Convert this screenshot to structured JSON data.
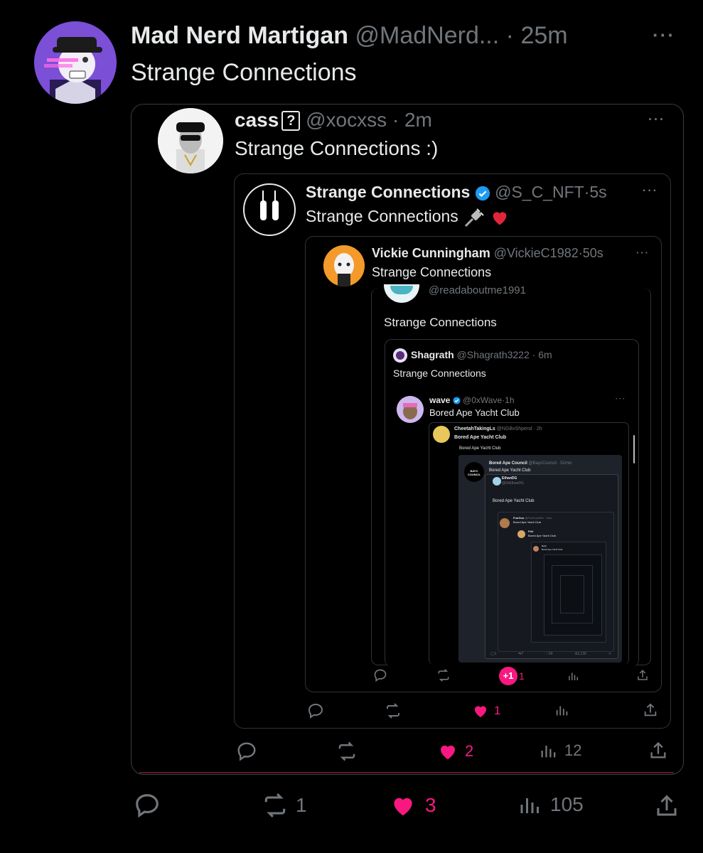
{
  "main": {
    "author": "Mad Nerd Martigan",
    "handle": "@MadNerd...",
    "sep": "·",
    "time": "25m",
    "text": "Strange Connections",
    "more": "···",
    "stats": {
      "reposts": "1",
      "likes": "3",
      "views": "105"
    }
  },
  "q1": {
    "author": "cass",
    "badge": "?",
    "handle": "@xocxss",
    "sep": "·",
    "time": "2m",
    "text": "Strange Connections :)",
    "more": "···",
    "stats": {
      "likes": "2",
      "views": "12"
    }
  },
  "q2": {
    "author": "Strange Connections",
    "handle": "@S_C_NFT",
    "sep": "·",
    "time": "5s",
    "text": "Strange Connections",
    "more": "···",
    "stats": {
      "likes": "1"
    }
  },
  "q3": {
    "author": "Vickie Cunningham",
    "handle": "@VickieC1982",
    "sep": "·",
    "time": "50s",
    "text": "Strange Connections",
    "more": "···",
    "stats": {
      "likes": "1",
      "plus": "+1"
    }
  },
  "q4": {
    "handle": "@readaboutme1991",
    "text": "Strange Connections"
  },
  "q5": {
    "author": "Shagrath",
    "handle": "@Shagrath3222",
    "sep": "·",
    "time": "6m",
    "text": "Strange Connections"
  },
  "q6": {
    "author": "wave",
    "handle": "@0xWave",
    "sep": "·",
    "time": "1h",
    "text": "Bored Ape Yacht Club",
    "more": "···"
  },
  "q7": {
    "author": "CheetahTakingLs",
    "handle": "@NGBxShpend · 2h",
    "text": "Bored Ape Yacht Club",
    "text2": "Bored Ape Yacht Club"
  },
  "q8": {
    "author": "Bored Ape Council",
    "handle": "@BaycCouncil · 52min",
    "text": "Bored Ape Yacht Club",
    "avatar_text": "BAYC COUNCIL",
    "sub_author": "EthanDG",
    "sub_handle": "@0xEthanDG",
    "sub_text": "Bored Ape Yacht Club",
    "deep1_author": "FunGuo",
    "deep1_handle": "@FunGuo42th · 16m",
    "deep1_text": "Bored Ape Yacht Club",
    "deep2_author": "Phil",
    "deep2_text": "Bored Ape Yacht Club",
    "deep3_author": "terry",
    "deep3_text": "Bored Ape Yacht Club",
    "stats": {
      "replies": "1",
      "reposts": "7",
      "likes": "24",
      "views": "1,130"
    }
  },
  "colors": {
    "bg": "#000000",
    "border": "#2f3336",
    "muted": "#71767b",
    "like": "#f91880",
    "verified": "#1d9bf0"
  }
}
